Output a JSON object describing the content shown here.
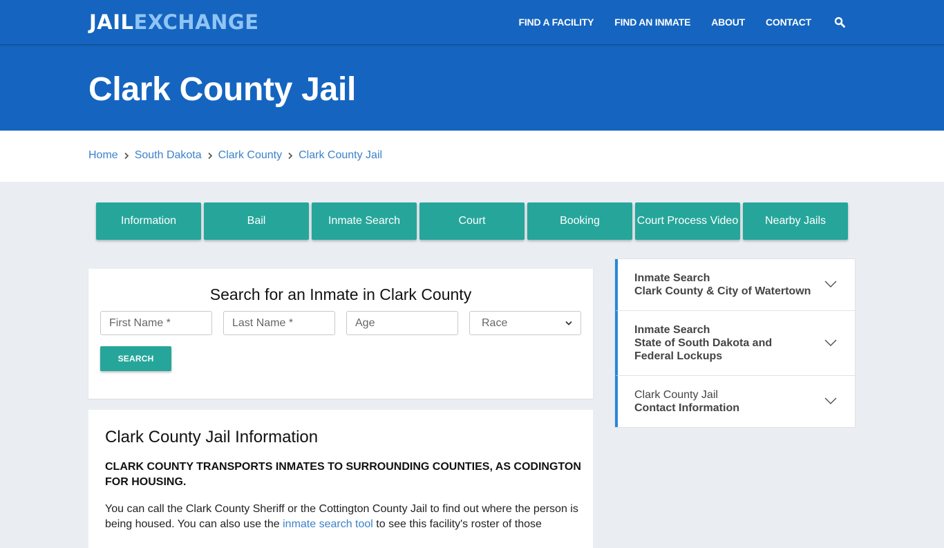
{
  "header": {
    "logo": {
      "part1": "JAIL",
      "part2": "EXCHANGE"
    },
    "nav": [
      {
        "label": "FIND A FACILITY"
      },
      {
        "label": "FIND AN INMATE"
      },
      {
        "label": "ABOUT"
      },
      {
        "label": "CONTACT"
      }
    ],
    "search_icon": "search-icon"
  },
  "hero": {
    "title": "Clark County Jail"
  },
  "breadcrumb": [
    {
      "label": "Home"
    },
    {
      "label": "South Dakota"
    },
    {
      "label": "Clark County"
    },
    {
      "label": "Clark County Jail"
    }
  ],
  "tabs": [
    {
      "label": "Information"
    },
    {
      "label": "Bail"
    },
    {
      "label": "Inmate Search"
    },
    {
      "label": "Court"
    },
    {
      "label": "Booking"
    },
    {
      "label": "Court Process Video"
    },
    {
      "label": "Nearby Jails"
    }
  ],
  "search_form": {
    "title": "Search for an Inmate in Clark County",
    "first_name_placeholder": "First Name *",
    "last_name_placeholder": "Last Name *",
    "age_placeholder": "Age",
    "race_selected": "Race",
    "button_label": "SEARCH"
  },
  "info": {
    "title": "Clark County Jail Information",
    "notice": "CLARK COUNTY TRANSPORTS INMATES TO SURROUNDING COUNTIES, AS CODINGTON FOR HOUSING.",
    "para_before": "You can call the Clark County Sheriff or the Cottington County Jail to find out where the person is being housed. You can also use the ",
    "para_link": "inmate search tool",
    "para_after": " to see this facility's roster of those"
  },
  "sidebar": {
    "items": [
      {
        "line1": "Inmate Search",
        "line2": "Clark County & City of Watertown",
        "line1_bold": true
      },
      {
        "line1": "Inmate Search",
        "line2": "State of South Dakota and Federal Lockups",
        "line1_bold": true
      },
      {
        "line1": "Clark County Jail",
        "line2": "Contact Information",
        "line1_bold": false
      }
    ]
  },
  "colors": {
    "primary_blue": "#1565c0",
    "logo_accent": "#90c4f5",
    "teal": "#26a69a",
    "link_blue": "#3b82c9",
    "accordion_accent": "#2a86d8"
  }
}
